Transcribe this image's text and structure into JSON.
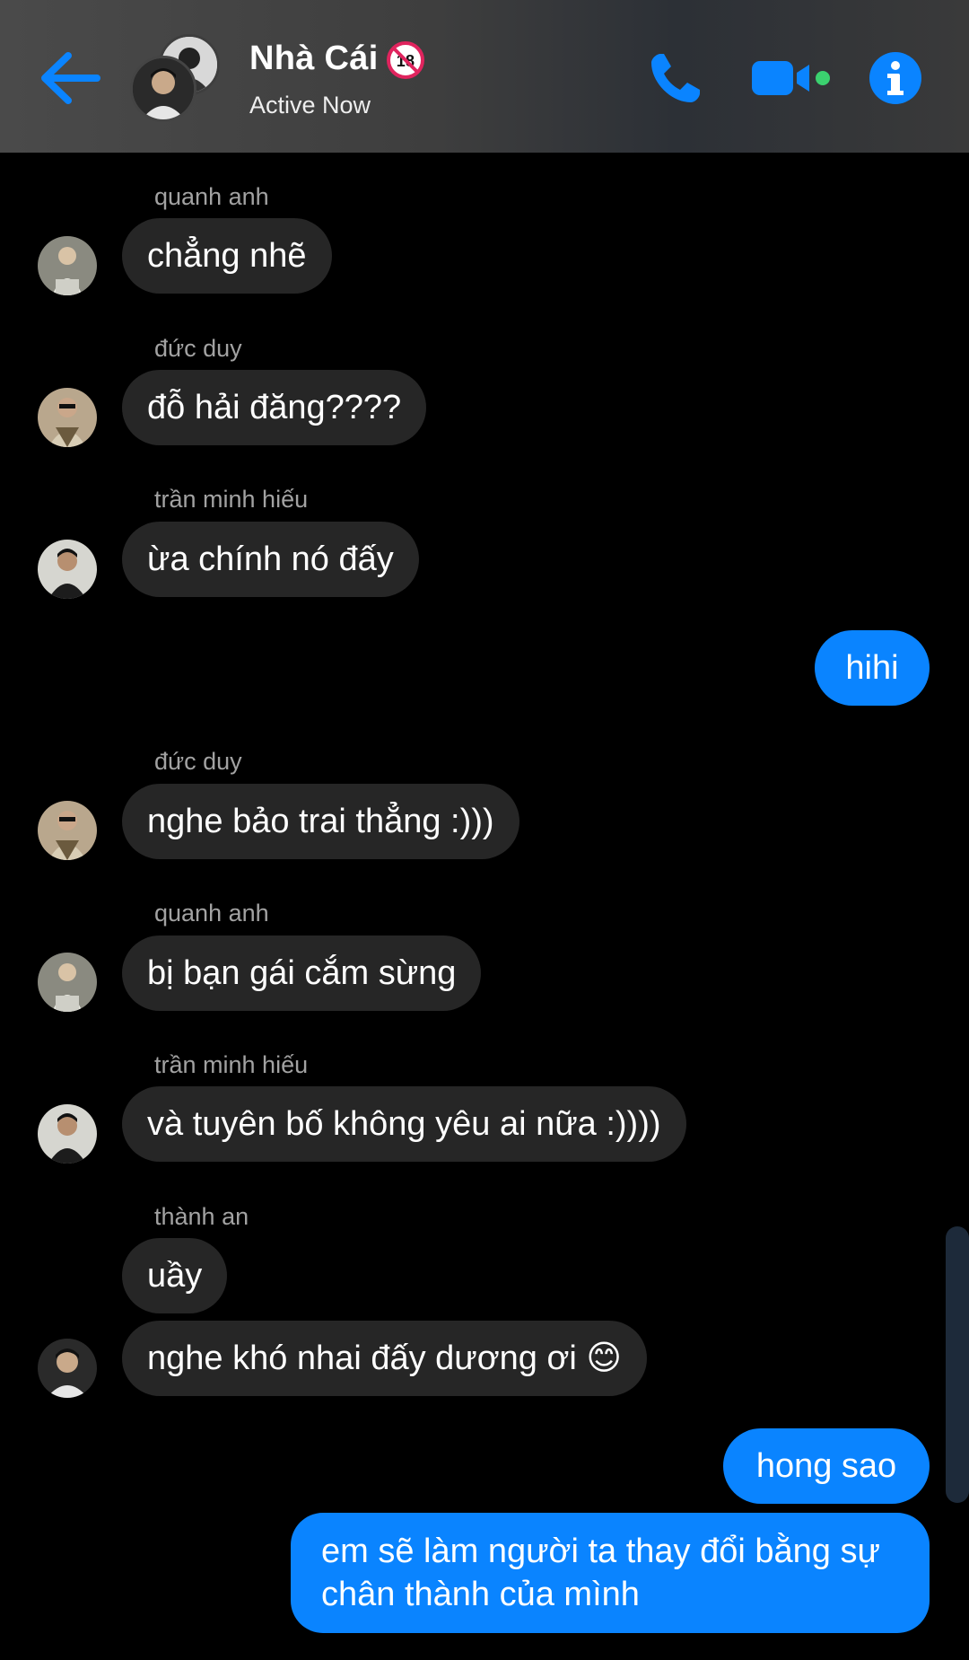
{
  "header": {
    "title": "Nhà Cái",
    "subtitle": "Active Now",
    "icons": [
      "back-arrow-icon",
      "phone-icon",
      "video-camera-icon",
      "info-icon"
    ],
    "accent_color": "#0a84ff"
  },
  "messages": [
    {
      "sender": "quanh anh",
      "text": "chẳng nhẽ"
    },
    {
      "sender": "đức duy",
      "text": "đỗ hải đăng????"
    },
    {
      "sender": "trần minh hiếu",
      "text": "ừa chính nó đấy"
    },
    {
      "sender": "me",
      "text": "hihi"
    },
    {
      "sender": "đức duy",
      "text": "nghe bảo trai thẳng :)))"
    },
    {
      "sender": "quanh anh",
      "text": "bị bạn gái cắm sừng"
    },
    {
      "sender": "trần minh hiếu",
      "text": "và tuyên bố không yêu ai nữa :))))"
    },
    {
      "sender": "thành an",
      "text": "uầy"
    },
    {
      "sender": "thành an",
      "text": "nghe khó nhai đấy dương ơi 😊"
    },
    {
      "sender": "me",
      "text": "hong sao"
    },
    {
      "sender": "me",
      "text_line1": "em sẽ làm người ta thay đổi bằng sự",
      "text_line2": "chân thành của mình"
    }
  ]
}
